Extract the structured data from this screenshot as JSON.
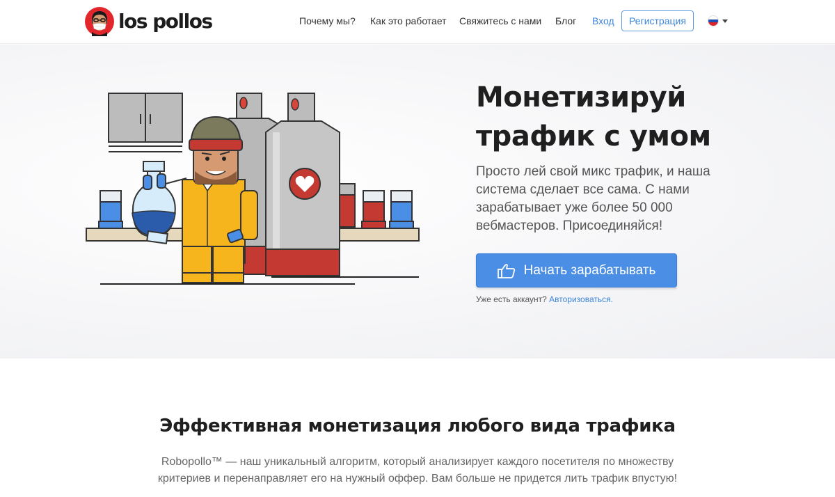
{
  "brand": {
    "name": "los pollos",
    "accent": "#4a8ee6"
  },
  "nav": {
    "items": [
      {
        "label": "Почему мы?"
      },
      {
        "label": "Как это работает"
      },
      {
        "label": "Свяжитесь с нами"
      },
      {
        "label": "Блог"
      }
    ],
    "login_label": "Вход",
    "register_label": "Регистрация",
    "language": {
      "selected": "ru",
      "icon": "russia-flag-icon"
    }
  },
  "hero": {
    "title": "Монетизируй трафик с умом",
    "description": "Просто лей свой микс трафик, и наша система сделает все сама. С нами зарабатывает уже более 50 000 вебмастеров. Присоединяйся!",
    "cta_label": "Начать зарабатывать",
    "cta_icon": "thumbs-up-icon",
    "account_prompt": "Уже есть аккаунт?",
    "account_link": "Авторизоваться."
  },
  "section": {
    "title": "Эффективная монетизация любого вида трафика",
    "text": "Robopollo™ — наш уникальный алгоритм, который анализирует каждого посетителя по множеству критериев и перенаправляет его на нужный оффер. Вам больше не придется лить трафик впустую!"
  }
}
